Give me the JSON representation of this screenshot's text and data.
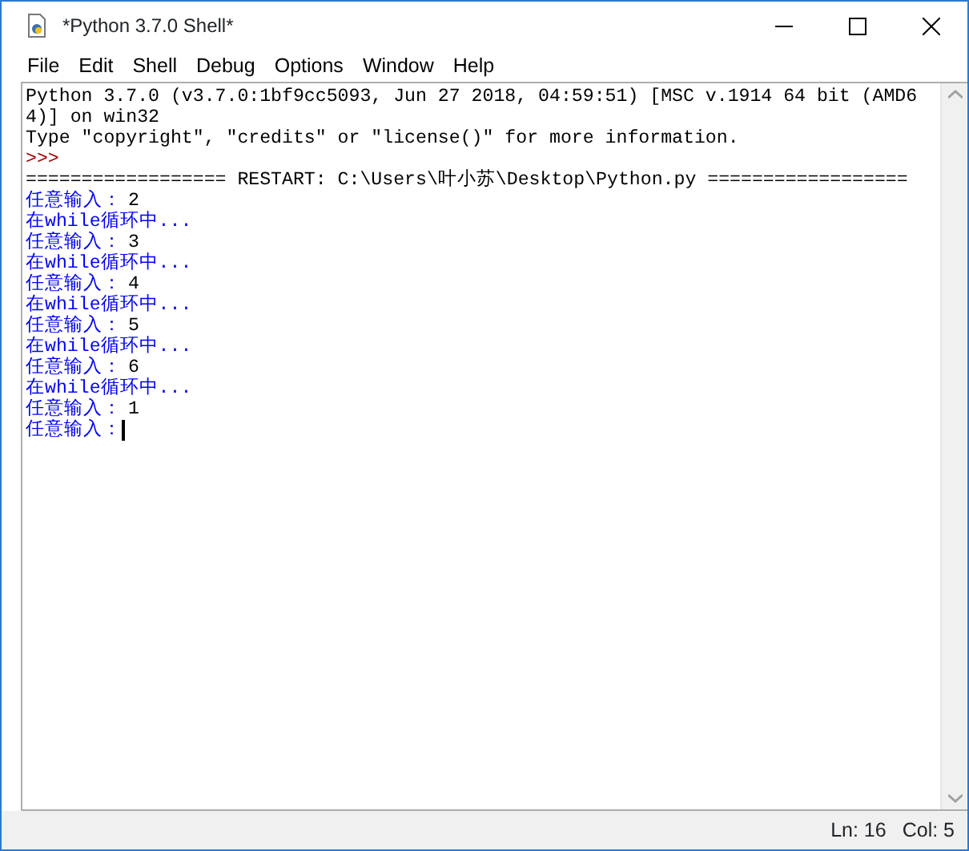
{
  "window": {
    "title": "*Python 3.7.0 Shell*"
  },
  "menu": [
    "File",
    "Edit",
    "Shell",
    "Debug",
    "Options",
    "Window",
    "Help"
  ],
  "lines": [
    [
      {
        "kind": "output",
        "text": "Python 3.7.0 (v3.7.0:1bf9cc5093, Jun 27 2018, 04:59:51) [MSC v.1914 64 bit (AMD6"
      }
    ],
    [
      {
        "kind": "output",
        "text": "4)] on win32"
      }
    ],
    [
      {
        "kind": "output",
        "text": "Type \"copyright\", \"credits\" or \"license()\" for more information."
      }
    ],
    [
      {
        "kind": "prompt",
        "text": ">>>"
      }
    ],
    [
      {
        "kind": "output",
        "text": "================== RESTART: C:\\Users\\叶小苏\\Desktop\\Python.py =================="
      }
    ],
    [
      {
        "kind": "stdout",
        "text": "任意输入："
      },
      {
        "kind": "input",
        "text": "2"
      }
    ],
    [
      {
        "kind": "stdout",
        "text": "在while循环中..."
      }
    ],
    [
      {
        "kind": "stdout",
        "text": "任意输入："
      },
      {
        "kind": "input",
        "text": "3"
      }
    ],
    [
      {
        "kind": "stdout",
        "text": "在while循环中..."
      }
    ],
    [
      {
        "kind": "stdout",
        "text": "任意输入："
      },
      {
        "kind": "input",
        "text": "4"
      }
    ],
    [
      {
        "kind": "stdout",
        "text": "在while循环中..."
      }
    ],
    [
      {
        "kind": "stdout",
        "text": "任意输入："
      },
      {
        "kind": "input",
        "text": "5"
      }
    ],
    [
      {
        "kind": "stdout",
        "text": "在while循环中..."
      }
    ],
    [
      {
        "kind": "stdout",
        "text": "任意输入："
      },
      {
        "kind": "input",
        "text": "6"
      }
    ],
    [
      {
        "kind": "stdout",
        "text": "在while循环中..."
      }
    ],
    [
      {
        "kind": "stdout",
        "text": "任意输入："
      },
      {
        "kind": "input",
        "text": "1"
      }
    ],
    [
      {
        "kind": "stdout",
        "text": "任意输入："
      },
      {
        "kind": "caret"
      }
    ]
  ],
  "status_bar": {
    "line": "Ln: 16",
    "column": "Col: 5"
  }
}
